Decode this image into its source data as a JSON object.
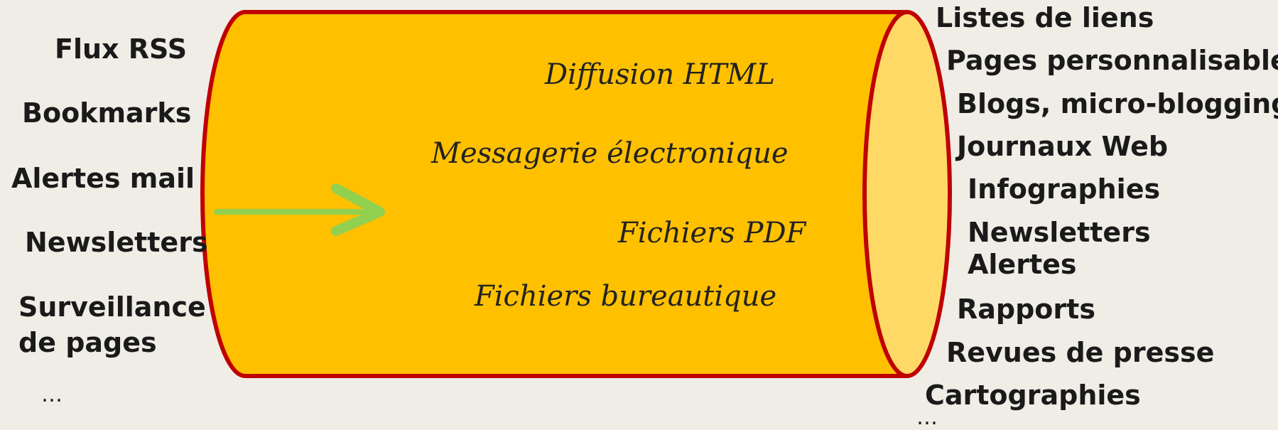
{
  "inputs": [
    "Flux RSS",
    "Bookmarks",
    "Alertes mail",
    "Newsletters",
    "Surveillance",
    "de pages",
    "…"
  ],
  "channels": [
    "Diffusion HTML",
    "Messagerie électronique",
    "Fichiers PDF",
    "Fichiers bureautique"
  ],
  "outputs": [
    "Listes de liens",
    "Pages personnalisables",
    "Blogs, micro-blogging",
    "Journaux Web",
    "Infographies",
    "Newsletters",
    "Alertes",
    "Rapports",
    "Revues de presse",
    "Cartographies",
    "…"
  ],
  "colors": {
    "background": "#efede6",
    "cylinder_fill": "#ffc000",
    "cylinder_end": "#ffd966",
    "cylinder_stroke": "#c00000",
    "arrow": "#92d050"
  }
}
